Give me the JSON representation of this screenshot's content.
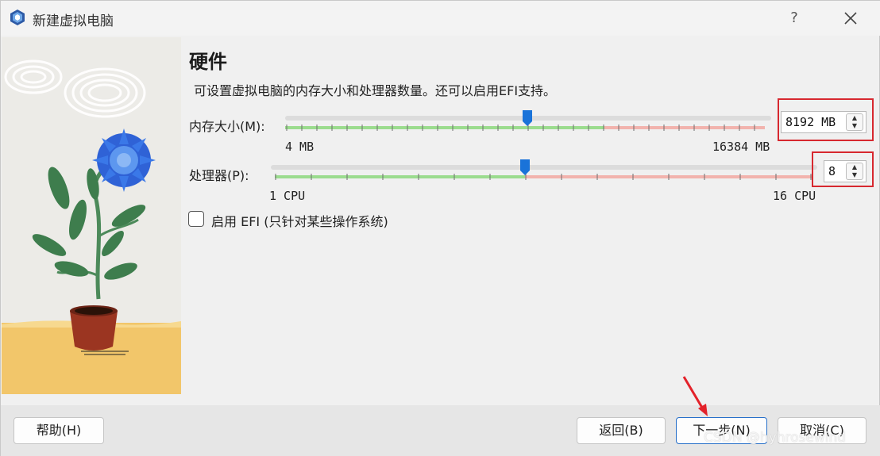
{
  "window": {
    "title": "新建虚拟电脑",
    "help_label": "?"
  },
  "section": {
    "title": "硬件",
    "description": "可设置虚拟电脑的内存大小和处理器数量。还可以启用EFI支持。"
  },
  "memory": {
    "label": "内存大小(M):",
    "min_label": "4 MB",
    "max_label": "16384 MB",
    "value_text": "8192 MB",
    "value": 8192,
    "min": 4,
    "max": 16384
  },
  "cpu": {
    "label": "处理器(P):",
    "min_label": "1 CPU",
    "max_label": "16 CPU",
    "value_text": "8",
    "value": 8,
    "min": 1,
    "max": 16
  },
  "efi": {
    "label": "启用 EFI (只针对某些操作系统)",
    "checked": false
  },
  "buttons": {
    "help": "帮助(H)",
    "back": "返回(B)",
    "next": "下一步(N)",
    "cancel": "取消(C)"
  },
  "watermark": "CSDN @hyhrosewind",
  "icons": {
    "app": "virtualbox-icon",
    "close": "close-icon",
    "spin_up": "chevron-up-icon",
    "spin_down": "chevron-down-icon"
  },
  "colors": {
    "accent": "#1a73d9",
    "ok_range": "#9bdc8e",
    "warn_range": "#f2b3ad",
    "highlight": "#d7282f",
    "annotation_arrow": "#e3222a"
  }
}
